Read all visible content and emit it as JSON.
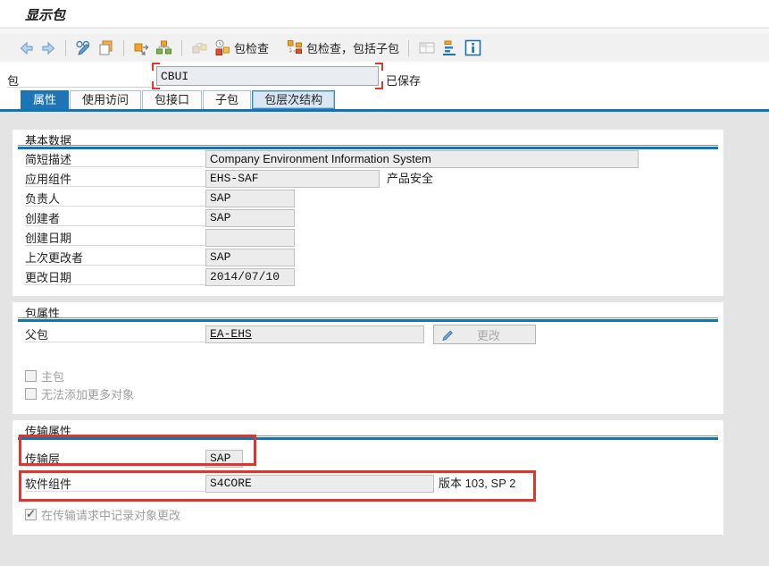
{
  "window": {
    "title": "显示包"
  },
  "toolbar": {
    "icons": [
      "back-icon",
      "forward-icon",
      "display-change-icon",
      "copy-icon",
      "move-icon",
      "hierarchy-icon",
      "check-objects-icon",
      "package-check-icon",
      "package-check-subpackages-icon",
      "table-view-icon",
      "sort-icon",
      "info-icon"
    ],
    "package_check_label": "包检查",
    "package_check_sub_label": "包检查，包括子包"
  },
  "header": {
    "package_label": "包",
    "package_value": "CBUI",
    "status": "已保存"
  },
  "tabs": [
    {
      "label": "属性",
      "active": true
    },
    {
      "label": "使用访问",
      "active": false
    },
    {
      "label": "包接口",
      "active": false
    },
    {
      "label": "子包",
      "active": false
    },
    {
      "label": "包层次结构",
      "active": false,
      "highlighted": true
    }
  ],
  "sections": {
    "basic": {
      "title": "基本数据",
      "rows": [
        {
          "label": "简短描述",
          "value": "Company Environment Information System"
        },
        {
          "label": "应用组件",
          "value": "EHS-SAF",
          "suffix": "产品安全"
        },
        {
          "label": "负责人",
          "value": "SAP"
        },
        {
          "label": "创建者",
          "value": "SAP"
        },
        {
          "label": "创建日期",
          "value": ""
        },
        {
          "label": "上次更改者",
          "value": "SAP"
        },
        {
          "label": "更改日期",
          "value": "2014/07/10"
        }
      ]
    },
    "attributes": {
      "title": "包属性",
      "superpackage_label": "父包",
      "superpackage_value": "EA-EHS",
      "change_button_label": "更改",
      "checkboxes": [
        {
          "label": "主包",
          "checked": false
        },
        {
          "label": "无法添加更多对象",
          "checked": false
        }
      ]
    },
    "transport": {
      "title": "传输属性",
      "transport_layer_label": "传输层",
      "transport_layer_value": "SAP",
      "software_component_label": "软件组件",
      "software_component_value": "S4CORE",
      "version_text": "版本 103, SP 2",
      "checkbox": {
        "label": "在传输请求中记录对象更改",
        "checked": true
      }
    }
  },
  "colors": {
    "accent_blue": "#0f76b6",
    "active_tab_blue": "#1b75b7",
    "annotation_red": "#e0352b",
    "page_bg": "#e4e4e4",
    "panel_bg": "#ffffff",
    "field_bg": "#ececec",
    "toolbar_bg": "#f1f1f1"
  }
}
